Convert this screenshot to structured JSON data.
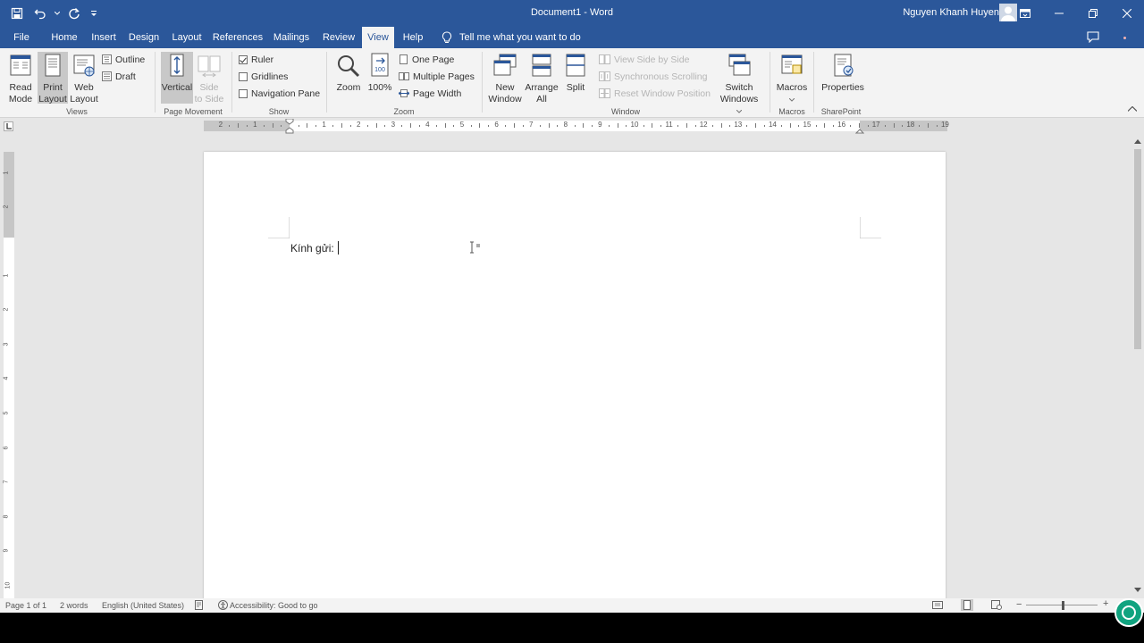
{
  "titlebar": {
    "title": "Document1  -  Word",
    "user": "Nguyen Khanh Huyen"
  },
  "tabs": [
    {
      "label": "File"
    },
    {
      "label": "Home"
    },
    {
      "label": "Insert"
    },
    {
      "label": "Design"
    },
    {
      "label": "Layout"
    },
    {
      "label": "References"
    },
    {
      "label": "Mailings"
    },
    {
      "label": "Review"
    },
    {
      "label": "View",
      "active": true
    },
    {
      "label": "Help"
    }
  ],
  "tell_me": "Tell me what you want to do",
  "ribbon": {
    "views": {
      "label": "Views",
      "read_mode": [
        "Read",
        "Mode"
      ],
      "print_layout": [
        "Print",
        "Layout"
      ],
      "web_layout": [
        "Web",
        "Layout"
      ],
      "outline": "Outline",
      "draft": "Draft"
    },
    "page_movement": {
      "label": "Page Movement",
      "vertical": "Vertical",
      "side_to_side": [
        "Side",
        "to Side"
      ]
    },
    "show": {
      "label": "Show",
      "ruler": "Ruler",
      "ruler_checked": true,
      "gridlines": "Gridlines",
      "gridlines_checked": false,
      "navigation_pane": "Navigation Pane",
      "navigation_pane_checked": false
    },
    "zoom": {
      "label": "Zoom",
      "zoom": "Zoom",
      "hundred": "100%",
      "one_page": "One Page",
      "multiple_pages": "Multiple Pages",
      "page_width": "Page Width"
    },
    "window": {
      "label": "Window",
      "new_window": [
        "New",
        "Window"
      ],
      "arrange_all": [
        "Arrange",
        "All"
      ],
      "split": "Split",
      "view_side_by_side": "View Side by Side",
      "synchronous_scrolling": "Synchronous Scrolling",
      "reset_window_position": "Reset Window Position",
      "switch_windows": [
        "Switch",
        "Windows"
      ]
    },
    "macros": {
      "label": "Macros",
      "macros": "Macros"
    },
    "sharepoint": {
      "label": "SharePoint",
      "properties": "Properties"
    }
  },
  "ruler": {
    "h_numbers": [
      "2",
      "1",
      "1",
      "2",
      "3",
      "4",
      "5",
      "6",
      "7",
      "8",
      "9",
      "10",
      "11",
      "12",
      "13",
      "14",
      "15",
      "16",
      "17",
      "18",
      "19"
    ],
    "v_numbers": [
      "1",
      "2",
      "1",
      "2",
      "3",
      "4",
      "5",
      "6",
      "7",
      "8",
      "9",
      "10"
    ]
  },
  "document": {
    "text": "Kính gửi: "
  },
  "status": {
    "page": "Page 1 of 1",
    "words": "2 words",
    "language": "English (United States)",
    "accessibility": "Accessibility: Good to go"
  },
  "colors": {
    "brand": "#2b579a",
    "ribbon_bg": "#f3f3f3",
    "canvas_bg": "#e6e6e6",
    "fab": "#10a37f"
  }
}
